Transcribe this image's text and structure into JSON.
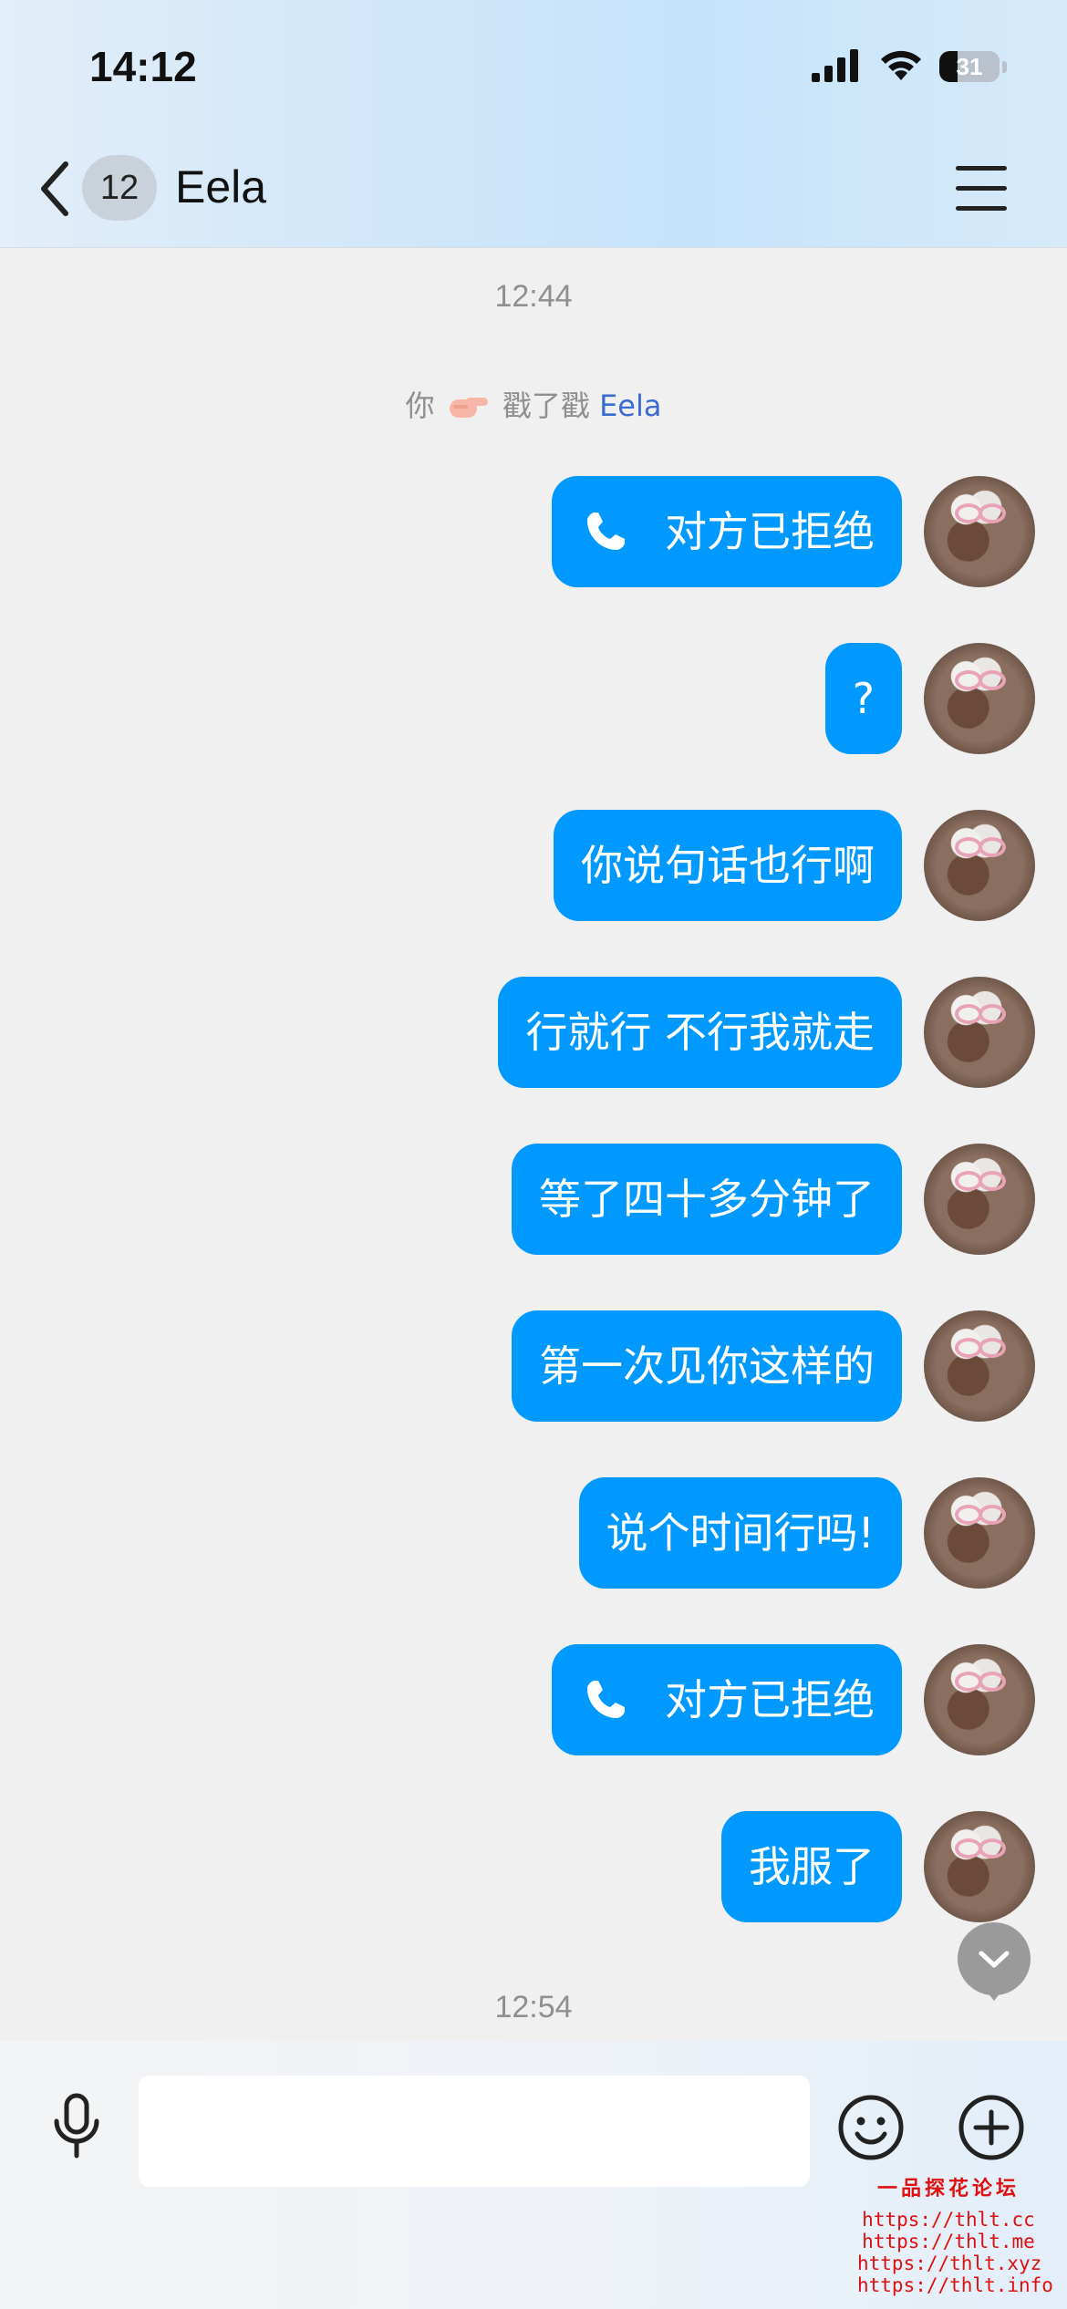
{
  "status_bar": {
    "time": "14:12",
    "battery_level": "31",
    "battery_fraction": 0.31
  },
  "header": {
    "unread_count": "12",
    "contact_name": "Eela",
    "back_icon": "chevron-left-icon",
    "menu_icon": "hamburger-menu-icon"
  },
  "chat": {
    "timestamp_1": "12:44",
    "poke": {
      "actor": "你",
      "action": "戳了戳",
      "target": "Eela"
    },
    "messages": [
      {
        "type": "call",
        "text": "对方已拒绝"
      },
      {
        "type": "text",
        "text": "?"
      },
      {
        "type": "text",
        "text": "你说句话也行啊"
      },
      {
        "type": "text",
        "text": "行就行 不行我就走"
      },
      {
        "type": "text",
        "text": "等了四十多分钟了"
      },
      {
        "type": "text",
        "text": "第一次见你这样的"
      },
      {
        "type": "text",
        "text": "说个时间行吗!"
      },
      {
        "type": "call",
        "text": "对方已拒绝"
      },
      {
        "type": "text",
        "text": "我服了"
      }
    ],
    "timestamp_2": "12:54"
  },
  "input_bar": {
    "value": "",
    "placeholder": ""
  },
  "watermark": {
    "title": "一品探花论坛",
    "lines": [
      "https://thlt.cc",
      "https://thlt.me",
      "https://thlt.xyz",
      "https://thlt.info"
    ]
  },
  "colors": {
    "bubble": "#0099ff",
    "timestamp": "#8f8f8f",
    "poke_name": "#3a6bd1",
    "watermark": "#e01010"
  }
}
